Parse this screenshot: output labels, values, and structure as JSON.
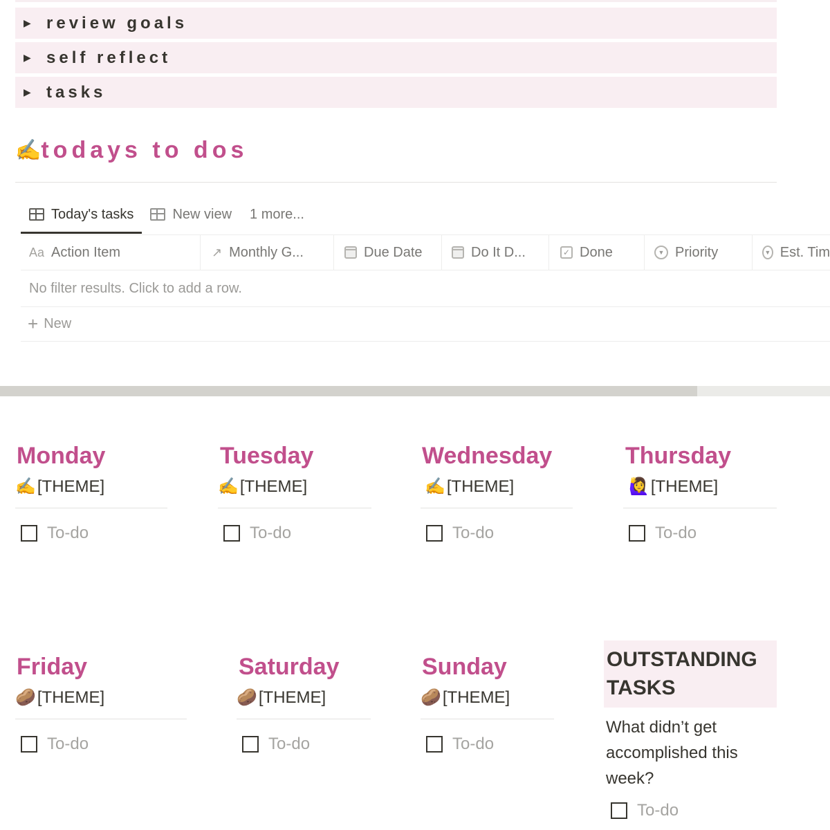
{
  "toggles": [
    {
      "label": "review goals"
    },
    {
      "label": "self reflect"
    },
    {
      "label": "tasks"
    }
  ],
  "todos_heading": {
    "emoji": "✍️",
    "text": "todays to dos"
  },
  "views": {
    "tabs": [
      {
        "label": "Today's tasks",
        "icon": "table-icon",
        "active": true
      },
      {
        "label": "New view",
        "icon": "table-icon",
        "active": false
      }
    ],
    "more": "1 more..."
  },
  "table": {
    "columns": [
      {
        "label": "Action Item",
        "icon": "Aa"
      },
      {
        "label": "Monthly G...",
        "icon": "↗"
      },
      {
        "label": "Due Date",
        "icon": "calendar"
      },
      {
        "label": "Do It D...",
        "icon": "calendar"
      },
      {
        "label": "Done",
        "icon": "checkbox"
      },
      {
        "label": "Priority",
        "icon": "select"
      },
      {
        "label": "Est. Tim",
        "icon": "select"
      }
    ],
    "empty_message": "No filter results. Click to add a row.",
    "new_label": "New"
  },
  "scrollbar": {
    "position_fraction": 0.84
  },
  "days": [
    {
      "name": "Monday",
      "emoji": "✍️",
      "theme": "[THEME]",
      "todo": "To-do"
    },
    {
      "name": "Tuesday",
      "emoji": "✍️",
      "theme": " [THEME]",
      "todo": "To-do"
    },
    {
      "name": "Wednesday",
      "emoji": "✍️",
      "theme": " [THEME]",
      "todo": "To-do"
    },
    {
      "name": "Thursday",
      "emoji": "🙋‍♀️",
      "theme": "[THEME]",
      "todo": "To-do"
    },
    {
      "name": "Friday",
      "emoji": "🥔",
      "theme": "[THEME]",
      "todo": "To-do"
    },
    {
      "name": "Saturday",
      "emoji": "🥔",
      "theme": "[THEME]",
      "todo": "To-do"
    },
    {
      "name": "Sunday",
      "emoji": "🥔",
      "theme": " [THEME]",
      "todo": "To-do"
    }
  ],
  "outstanding": {
    "title": "OUTSTANDING TASKS",
    "question": "What didn’t get accomplished this week?",
    "todo": "To-do"
  }
}
